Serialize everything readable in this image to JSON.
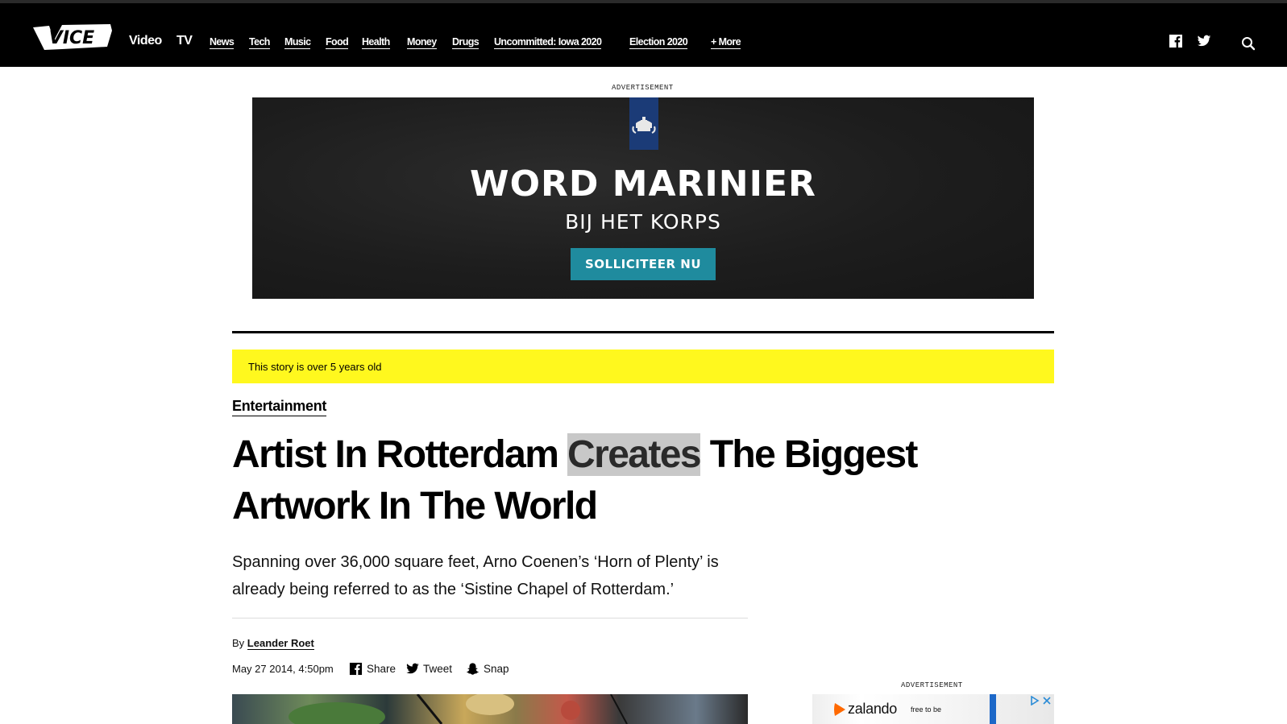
{
  "nav": {
    "logo_text": "VICE",
    "primary": [
      "Video",
      "TV"
    ],
    "secondary": [
      "News",
      "Tech",
      "Music",
      "Food",
      "Health",
      "Money",
      "Drugs",
      "Uncommitted: Iowa 2020",
      "Election 2020",
      "+ More"
    ]
  },
  "ad_top": {
    "label": "ADVERTISEMENT",
    "headline": "WORD MARINIER",
    "sub": "BIJ HET KORPS",
    "cta": "SOLLICITEER NU"
  },
  "article": {
    "age_banner": "This story is over 5 years old",
    "category": "Entertainment",
    "headline_before": "Artist In Rotterdam ",
    "headline_highlight": "Creates",
    "headline_after": " The Biggest Artwork In The World",
    "dek": "Spanning over 36,000 square feet, Arno Coenen’s ‘Horn of Plenty’ is already being referred to as the ‘Sistine Chapel of Rotterdam.’",
    "by_prefix": "By",
    "author": "Leander Roet",
    "date": "May 27 2014, 4:50pm",
    "share": {
      "facebook": "Share",
      "twitter": "Tweet",
      "snapchat": "Snap"
    }
  },
  "ad_side": {
    "label": "ADVERTISEMENT",
    "brand": "zalando",
    "tagline": "free to be"
  },
  "colors": {
    "banner": "#fff81e",
    "cta": "#1f8b9e",
    "crest": "#1b3b77"
  },
  "icons": [
    "vice-logo",
    "facebook-icon",
    "twitter-icon",
    "search-icon",
    "snapchat-icon",
    "adchoices-icon",
    "close-icon"
  ]
}
